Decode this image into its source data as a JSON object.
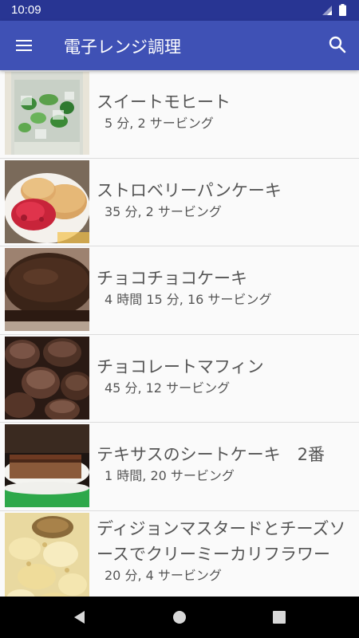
{
  "status": {
    "time": "10:09"
  },
  "app_bar": {
    "title": "電子レンジ調理",
    "menu_icon": "hamburger-menu-icon",
    "search_icon": "search-icon"
  },
  "recipes": [
    {
      "title": "スイートモヒート",
      "subtitle": "5 分, 2 サービング",
      "image": "mojito-drink-photo"
    },
    {
      "title": "ストロベリーパンケーキ",
      "subtitle": "35 分, 2 サービング",
      "image": "strawberry-pancake-photo"
    },
    {
      "title": "チョコチョコケーキ",
      "subtitle": "4 時間 15 分, 16 サービング",
      "image": "chocolate-cake-photo"
    },
    {
      "title": "チョコレートマフィン",
      "subtitle": "45 分, 12 サービング",
      "image": "chocolate-muffin-photo"
    },
    {
      "title": "テキサスのシートケーキ　2番",
      "subtitle": "1 時間, 20 サービング",
      "image": "texas-sheet-cake-photo"
    },
    {
      "title": "ディジョンマスタードとチーズソースでクリーミーカリフラワー",
      "subtitle": "20 分, 4 サービング",
      "image": "creamy-cauliflower-photo"
    }
  ],
  "nav": {
    "back_icon": "back-triangle-icon",
    "home_icon": "home-circle-icon",
    "recents_icon": "recents-square-icon"
  },
  "colors": {
    "status_bar": "#283593",
    "app_bar": "#3f51b5",
    "text": "#555555"
  }
}
